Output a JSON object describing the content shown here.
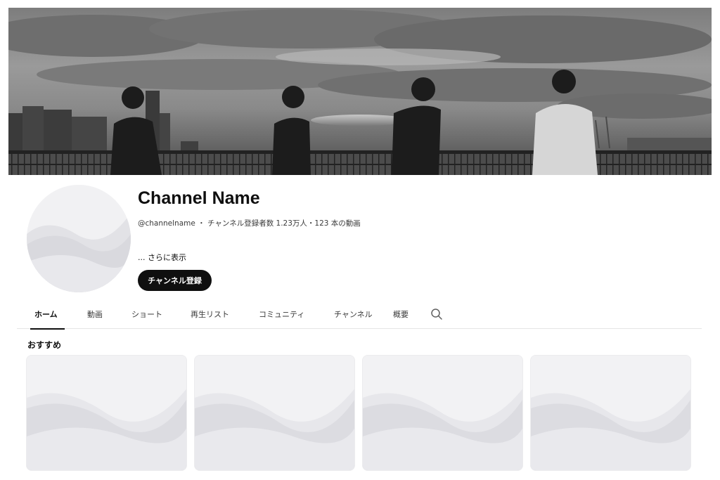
{
  "banner": {
    "description_icon": "band-photo-banner"
  },
  "channel": {
    "name": "Channel Name",
    "handle": "@channelname",
    "separator": " ・ ",
    "subscribers": "チャンネル登録者数 1.23万人",
    "dot": "・",
    "videos": "123 本の動画",
    "more": "... さらに表示",
    "subscribe_label": "チャンネル登録"
  },
  "tabs": [
    {
      "label": "ホーム",
      "active": true
    },
    {
      "label": "動画"
    },
    {
      "label": "ショート"
    },
    {
      "label": "再生リスト"
    },
    {
      "label": "コミュニティ"
    },
    {
      "label": "チャンネル"
    },
    {
      "label": "概要"
    }
  ],
  "search_icon": "search-icon",
  "section": {
    "title": "おすすめ"
  },
  "colors": {
    "accent": "#0f0f0f",
    "placeholder": "#e6e6ea"
  }
}
